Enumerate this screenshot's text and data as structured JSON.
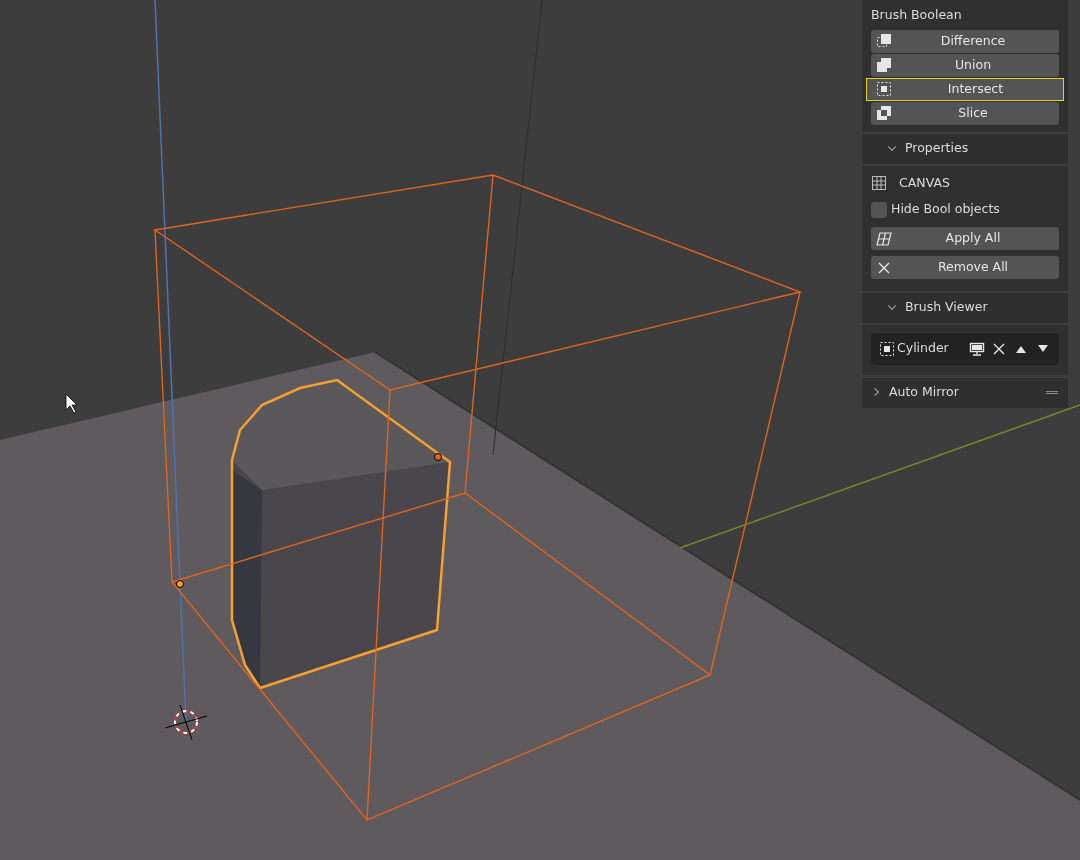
{
  "brush_boolean": {
    "title": "Brush Boolean",
    "operations": [
      {
        "label": "Difference",
        "kind": "difference",
        "selected": false
      },
      {
        "label": "Union",
        "kind": "union",
        "selected": false
      },
      {
        "label": "Intersect",
        "kind": "intersect",
        "selected": true
      },
      {
        "label": "Slice",
        "kind": "slice",
        "selected": false
      }
    ]
  },
  "properties": {
    "title": "Properties",
    "expanded": true,
    "canvas_label": "CANVAS",
    "hide_bool_objects": {
      "label": "Hide Bool objects",
      "checked": false
    },
    "buttons": [
      {
        "label": "Apply All",
        "kind": "apply"
      },
      {
        "label": "Remove All",
        "kind": "remove"
      }
    ]
  },
  "brush_viewer": {
    "title": "Brush Viewer",
    "expanded": true,
    "brushes": [
      {
        "name": "Cylinder"
      }
    ]
  },
  "auto_mirror": {
    "title": "Auto Mirror",
    "expanded": false
  }
}
